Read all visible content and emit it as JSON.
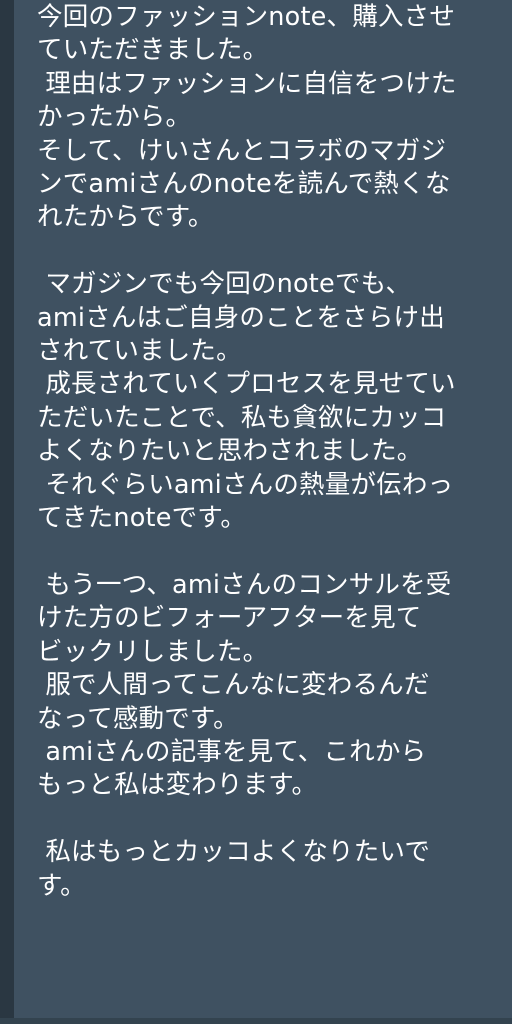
{
  "message": {
    "lines": [
      "今回のファッションnote、購入させ",
      "ていただきました。",
      " 理由はファッションに自信をつけた",
      "かったから。",
      "そして、けいさんとコラボのマガジ",
      "ンでamiさんのnoteを読んで熱くな",
      "れたからです。",
      "",
      " マガジンでも今回のnoteでも、",
      "amiさんはご自身のことをさらけ出",
      "されていました。",
      " 成長されていくプロセスを見せてい",
      "ただいたことで、私も貪欲にカッコ",
      "よくなりたいと思わされました。",
      " それぐらいamiさんの熱量が伝わっ",
      "てきたnoteです。",
      "",
      " もう一つ、amiさんのコンサルを受",
      "けた方のビフォーアフターを見て",
      "ビックリしました。",
      " 服で人間ってこんなに変わるんだ",
      "なって感動です。",
      " amiさんの記事を見て、これから",
      "もっと私は変わります。",
      "",
      " 私はもっとカッコよくなりたいで",
      "す。"
    ]
  },
  "colors": {
    "bubble_background": "#3f5161",
    "text": "#ffffff",
    "page_background": "#2c3a46"
  }
}
